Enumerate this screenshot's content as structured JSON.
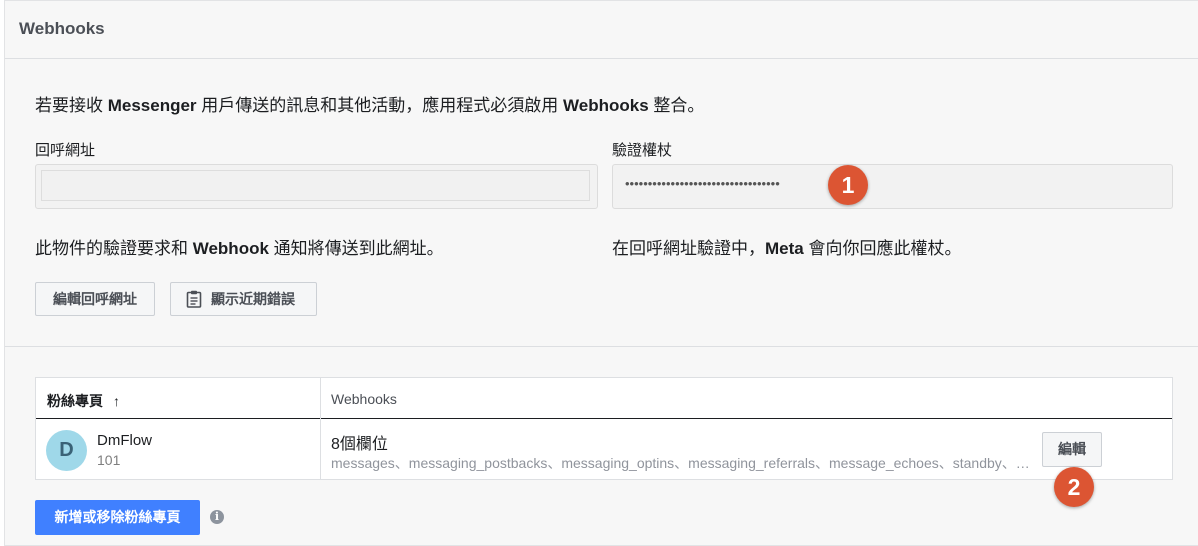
{
  "header": {
    "title": "Webhooks"
  },
  "description": {
    "prefix": "若要接收 ",
    "bold1": "Messenger",
    "middle": " 用戶傳送的訊息和其他活動，應用程式必須啟用 ",
    "bold2": "Webhooks",
    "suffix": " 整合。"
  },
  "callback": {
    "label": "回呼網址",
    "value": "",
    "help_prefix": "此物件的驗證要求和 ",
    "help_bold": "Webhook",
    "help_suffix": " 通知將傳送到此網址。"
  },
  "verify": {
    "label": "驗證權杖",
    "value_masked": "••••••••••••••••••••••••••••••••••",
    "help_prefix": "在回呼網址驗證中，",
    "help_bold": "Meta",
    "help_suffix": " 會向你回應此權杖。"
  },
  "buttons": {
    "edit_callback": "編輯回呼網址",
    "show_errors": "顯示近期錯誤",
    "edit_fields": "編輯",
    "add_remove_pages": "新增或移除粉絲專頁"
  },
  "markers": {
    "one": "1",
    "two": "2"
  },
  "table": {
    "headers": {
      "page": "粉絲專頁",
      "webhooks": "Webhooks"
    },
    "sort_icon": "↑",
    "rows": [
      {
        "avatar_letter": "D",
        "name": "DmFlow",
        "id": "101",
        "fields_count": "8個欄位",
        "fields": "messages、messaging_postbacks、messaging_optins、messaging_referrals、message_echoes、standby、messaging_handovers、message_reads"
      }
    ]
  },
  "colors": {
    "marker": "#dc5533",
    "primary": "#4080ff",
    "avatar": "#9fd8e9"
  },
  "icons": {
    "clipboard": "clipboard-icon",
    "info": "info-icon",
    "sort": "arrow-up-icon"
  }
}
